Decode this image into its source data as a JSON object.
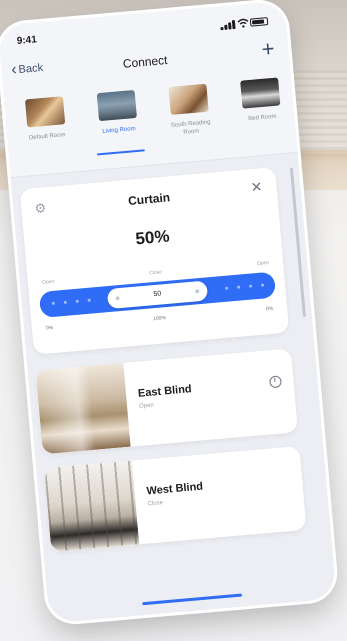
{
  "status_bar": {
    "time": "9:41"
  },
  "nav": {
    "back_label": "Back",
    "title": "Connect",
    "add_symbol": "+"
  },
  "rooms": [
    {
      "label": "Default Room",
      "active": false
    },
    {
      "label": "Living Room",
      "active": true
    },
    {
      "label": "South Reading Room",
      "active": false
    },
    {
      "label": "Bed Room",
      "active": false
    }
  ],
  "curtain": {
    "title": "Curtain",
    "percent_label": "50%",
    "open_left": "Open",
    "close_label": "Close",
    "open_right": "Open",
    "slider_value": "50",
    "scale_left": "0%",
    "scale_mid": "100%",
    "scale_right": "0%"
  },
  "blinds": [
    {
      "title": "East Blind",
      "subtitle": "Open",
      "has_timer": true
    },
    {
      "title": "West Blind",
      "subtitle": "Close",
      "has_timer": false
    }
  ],
  "colors": {
    "accent": "#2f6df6",
    "text_primary": "#1c1c1e",
    "text_secondary": "#9aa1ad",
    "card": "#ffffff",
    "background": "#eceef3"
  }
}
